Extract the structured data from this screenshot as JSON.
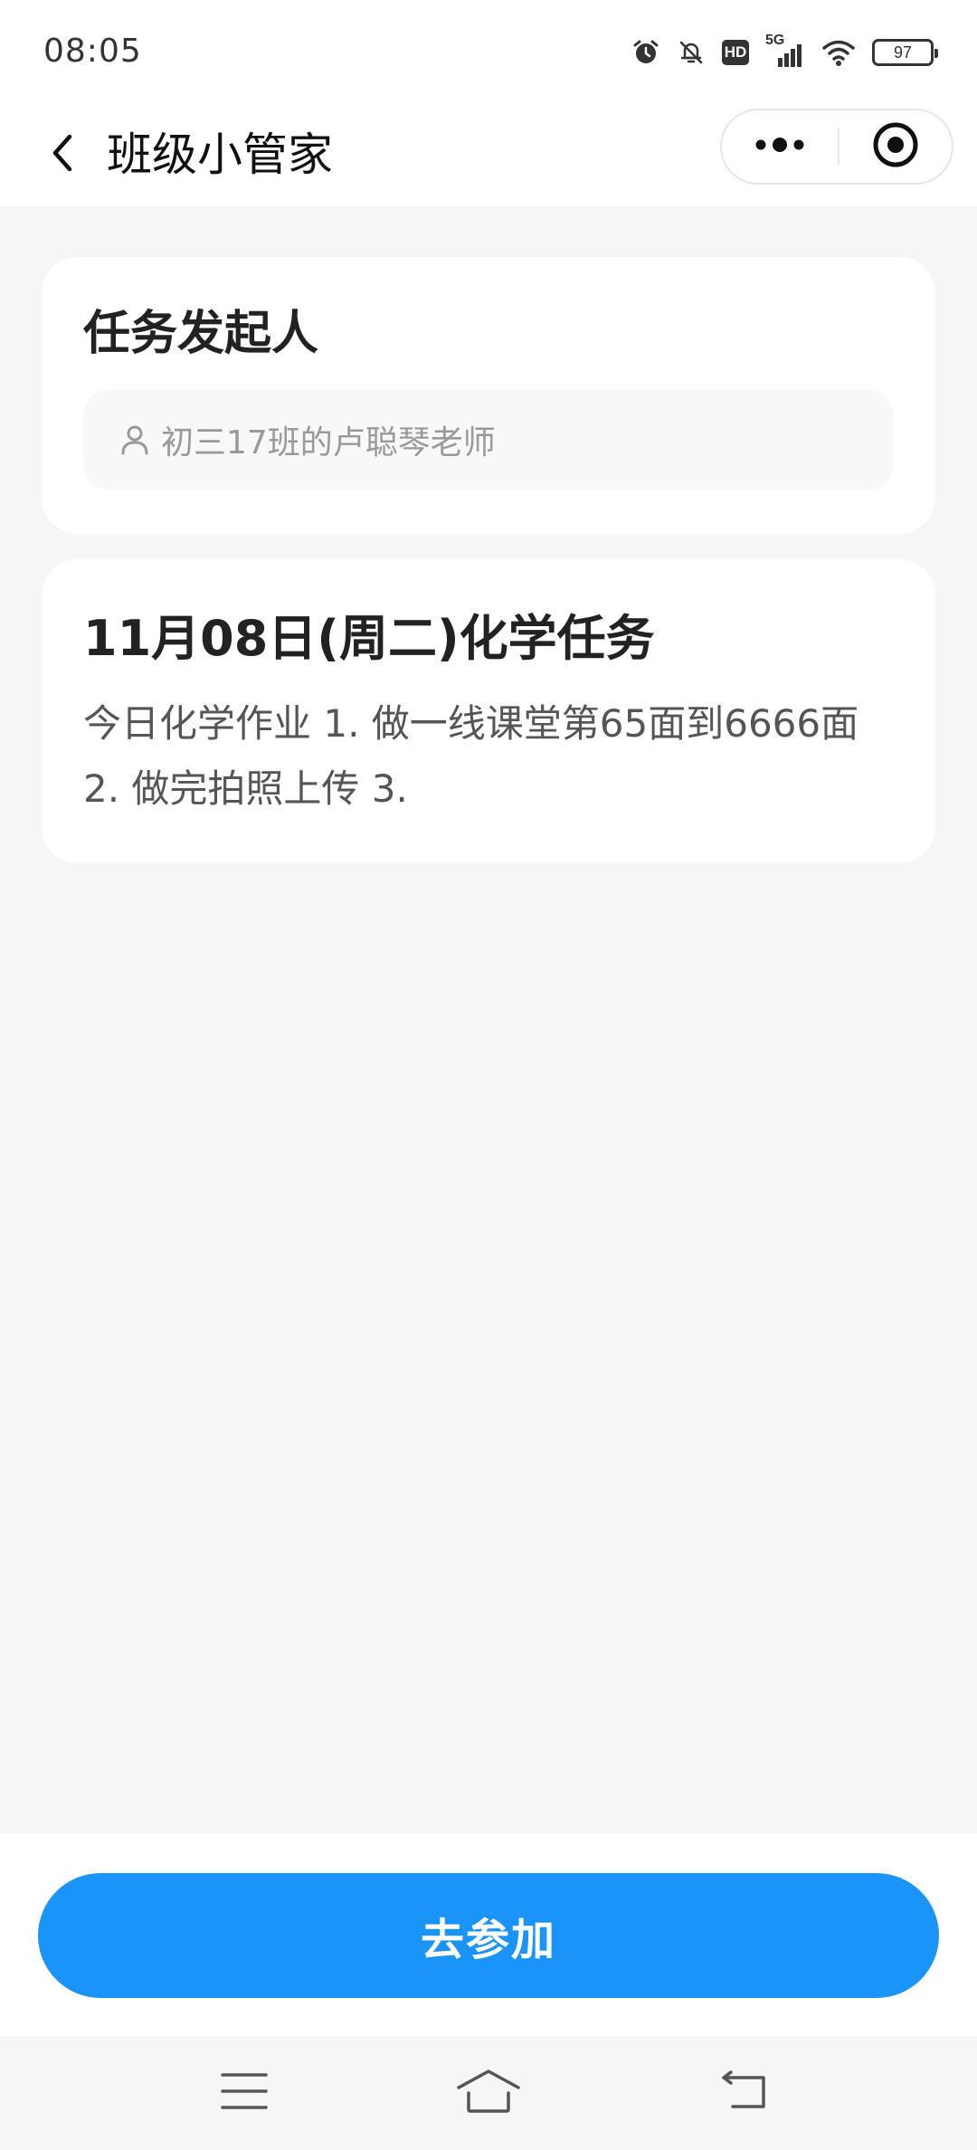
{
  "status_bar": {
    "time": "08:05",
    "network_label": "5G",
    "hd_label": "HD",
    "battery_level": "97",
    "icons": [
      "alarm-icon",
      "bell-off-icon",
      "hd-icon",
      "signal-icon",
      "wifi-icon",
      "battery-icon"
    ]
  },
  "nav": {
    "title": "班级小管家",
    "back_icon": "chevron-left-icon",
    "more_icon": "more-dots-icon",
    "close_icon": "target-circle-icon"
  },
  "initiator_card": {
    "heading": "任务发起人",
    "icon": "person-icon",
    "name": "初三17班的卢聪琴老师"
  },
  "task_card": {
    "title": "11月08日(周二)化学任务",
    "description": "今日化学作业 1. 做一线课堂第65面到6666面 2. 做完拍照上传 3."
  },
  "actions": {
    "join_label": "去参加"
  },
  "system_nav": {
    "icons": [
      "menu-icon",
      "home-icon",
      "back-icon"
    ]
  },
  "colors": {
    "primary": "#1a94f8",
    "page_background": "#f6f6f6",
    "card_background": "#ffffff",
    "input_background": "#f7f8fa"
  }
}
